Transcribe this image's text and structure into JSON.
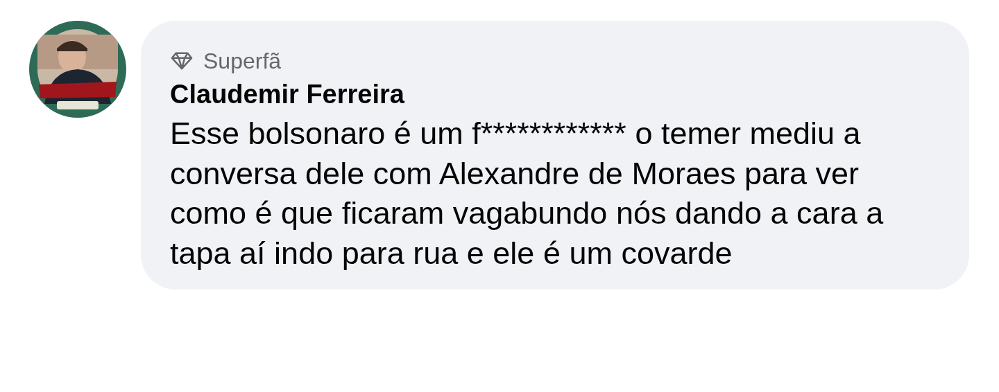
{
  "comment": {
    "badge": "Superfã",
    "author": "Claudemir Ferreira",
    "text": "Esse bolsonaro é um f************ o temer mediu a conversa dele com Alexandre de Moraes para ver como é que ficaram vagabundo nós dando a cara a tapa aí indo para rua e ele é um covarde"
  }
}
